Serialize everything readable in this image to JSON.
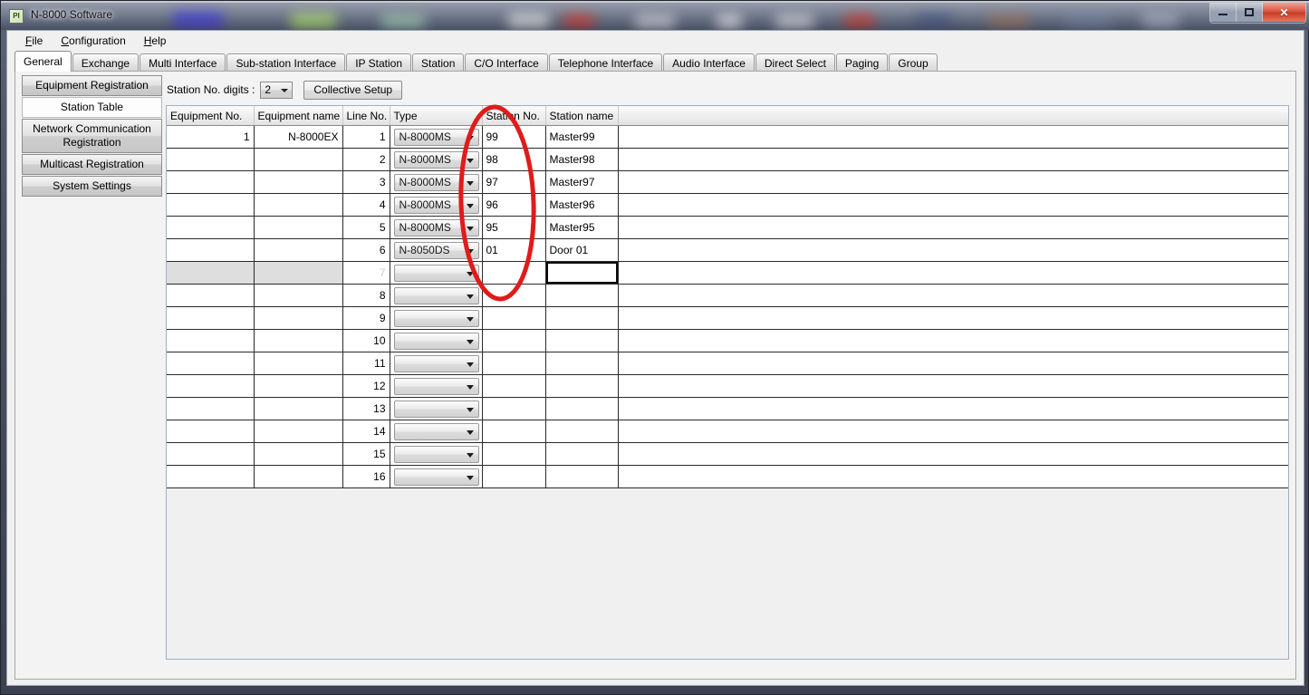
{
  "window": {
    "title": "N-8000 Software",
    "icon_label": "PI",
    "controls": {
      "minimize": "minimize-button",
      "maximize": "maximize-button",
      "close": "✕"
    }
  },
  "menubar": {
    "items": [
      {
        "label": "File",
        "accel": "F"
      },
      {
        "label": "Configuration",
        "accel": "C"
      },
      {
        "label": "Help",
        "accel": "H"
      }
    ]
  },
  "tabs": {
    "active": "General",
    "items": [
      "General",
      "Exchange",
      "Multi Interface",
      "Sub-station Interface",
      "IP Station",
      "Station",
      "C/O Interface",
      "Telephone Interface",
      "Audio Interface",
      "Direct Select",
      "Paging",
      "Group"
    ]
  },
  "sidebar": {
    "items": [
      {
        "label": "Equipment Registration",
        "selected": false
      },
      {
        "label": "Station Table",
        "selected": true
      },
      {
        "label": "Network Communication Registration",
        "selected": false
      },
      {
        "label": "Multicast Registration",
        "selected": false
      },
      {
        "label": "System Settings",
        "selected": false
      }
    ]
  },
  "toolbar": {
    "digits_label": "Station No. digits :",
    "digits_value": "2",
    "collective_setup_label": "Collective Setup"
  },
  "table": {
    "headers": [
      "Equipment No.",
      "Equipment name",
      "Line No.",
      "Type",
      "Station No.",
      "Station name",
      ""
    ],
    "rows": [
      {
        "equipment_no": "1",
        "equipment_name": "N-8000EX",
        "line_no": "1",
        "type": "N-8000MS",
        "station_no": "99",
        "station_name": "Master99",
        "selected": false
      },
      {
        "equipment_no": "",
        "equipment_name": "",
        "line_no": "2",
        "type": "N-8000MS",
        "station_no": "98",
        "station_name": "Master98",
        "selected": false
      },
      {
        "equipment_no": "",
        "equipment_name": "",
        "line_no": "3",
        "type": "N-8000MS",
        "station_no": "97",
        "station_name": "Master97",
        "selected": false
      },
      {
        "equipment_no": "",
        "equipment_name": "",
        "line_no": "4",
        "type": "N-8000MS",
        "station_no": "96",
        "station_name": "Master96",
        "selected": false
      },
      {
        "equipment_no": "",
        "equipment_name": "",
        "line_no": "5",
        "type": "N-8000MS",
        "station_no": "95",
        "station_name": "Master95",
        "selected": false
      },
      {
        "equipment_no": "",
        "equipment_name": "",
        "line_no": "6",
        "type": "N-8050DS",
        "station_no": "01",
        "station_name": "Door 01",
        "selected": false
      },
      {
        "equipment_no": "",
        "equipment_name": "",
        "line_no": "7",
        "type": "",
        "station_no": "",
        "station_name": "",
        "selected": true
      },
      {
        "equipment_no": "",
        "equipment_name": "",
        "line_no": "8",
        "type": "",
        "station_no": "",
        "station_name": "",
        "selected": false
      },
      {
        "equipment_no": "",
        "equipment_name": "",
        "line_no": "9",
        "type": "",
        "station_no": "",
        "station_name": "",
        "selected": false
      },
      {
        "equipment_no": "",
        "equipment_name": "",
        "line_no": "10",
        "type": "",
        "station_no": "",
        "station_name": "",
        "selected": false
      },
      {
        "equipment_no": "",
        "equipment_name": "",
        "line_no": "11",
        "type": "",
        "station_no": "",
        "station_name": "",
        "selected": false
      },
      {
        "equipment_no": "",
        "equipment_name": "",
        "line_no": "12",
        "type": "",
        "station_no": "",
        "station_name": "",
        "selected": false
      },
      {
        "equipment_no": "",
        "equipment_name": "",
        "line_no": "13",
        "type": "",
        "station_no": "",
        "station_name": "",
        "selected": false
      },
      {
        "equipment_no": "",
        "equipment_name": "",
        "line_no": "14",
        "type": "",
        "station_no": "",
        "station_name": "",
        "selected": false
      },
      {
        "equipment_no": "",
        "equipment_name": "",
        "line_no": "15",
        "type": "",
        "station_no": "",
        "station_name": "",
        "selected": false
      },
      {
        "equipment_no": "",
        "equipment_name": "",
        "line_no": "16",
        "type": "",
        "station_no": "",
        "station_name": "",
        "selected": false
      }
    ]
  },
  "annotation": {
    "shape": "ellipse",
    "color": "#e01b1b",
    "targets_column": "Station No."
  }
}
